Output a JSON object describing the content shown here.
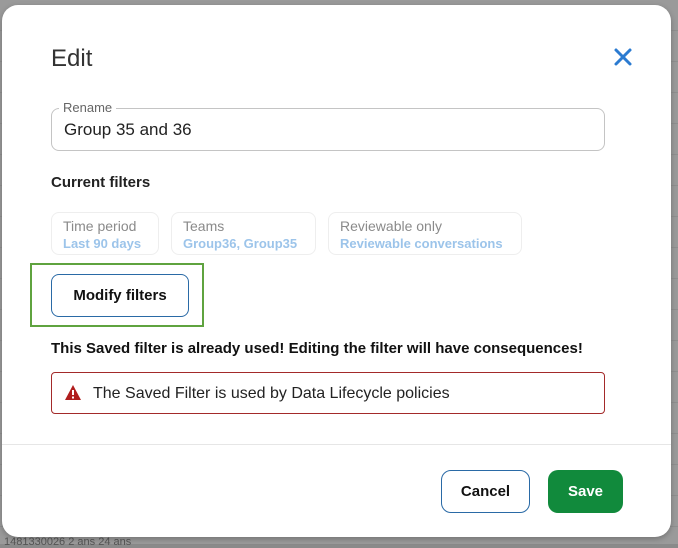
{
  "backdrop": {
    "text": "1481330026   2 ans  24 ans"
  },
  "dialog": {
    "title": "Edit",
    "rename": {
      "label": "Rename",
      "value": "Group 35 and 36"
    },
    "current_filters_label": "Current filters",
    "filters": [
      {
        "label": "Time period",
        "value": "Last 90 days"
      },
      {
        "label": "Teams",
        "value": "Group36, Group35"
      },
      {
        "label": "Reviewable only",
        "value": "Reviewable conversations"
      }
    ],
    "modify_filters_label": "Modify filters",
    "warning_text": "This Saved filter is already used! Editing the filter will have consequences!",
    "alert": {
      "text": "The Saved Filter is used by Data Lifecycle policies"
    },
    "cancel_label": "Cancel",
    "save_label": "Save"
  },
  "colors": {
    "close_icon": "#2b7bd1",
    "save_button": "#118a3c",
    "alert_border": "#a32a2a",
    "alert_icon": "#b01e1e",
    "highlight_border": "#5fa33f",
    "filter_value": "#9cc4ea"
  },
  "icons": {
    "close": "close-icon",
    "alert": "warning-triangle-icon"
  }
}
